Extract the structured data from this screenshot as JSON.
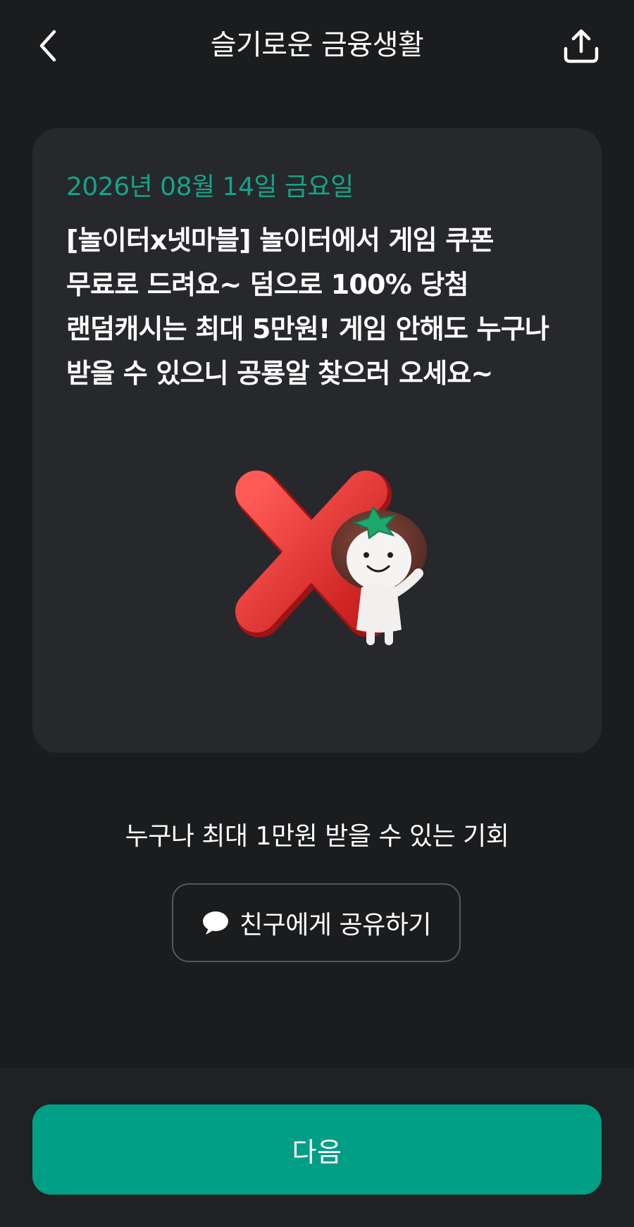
{
  "header": {
    "title": "슬기로운 금융생활",
    "back_icon": "chevron-left-icon",
    "share_icon": "upload-share-icon"
  },
  "card": {
    "date": "2026년 08월 14일 금요일",
    "body": "[놀이터x넷마블] 놀이터에서 게임 쿠폰\n무료로 드려요~ 덤으로 100% 당첨\n랜덤캐시는 최대 5만원! 게임 안해도 누구나\n받을 수 있으니 공룡알 찾으러 오세요~",
    "illustration": "red-x-with-character-illustration"
  },
  "promo": {
    "text": "누구나 최대 1만원 받을 수 있는 기회"
  },
  "share_button": {
    "label": "친구에게 공유하기",
    "icon": "speech-bubble-icon"
  },
  "footer": {
    "next_label": "다음"
  },
  "colors": {
    "background": "#1b1c1e",
    "card": "#27282b",
    "accent": "#009e85",
    "date_text": "#14a48b"
  }
}
